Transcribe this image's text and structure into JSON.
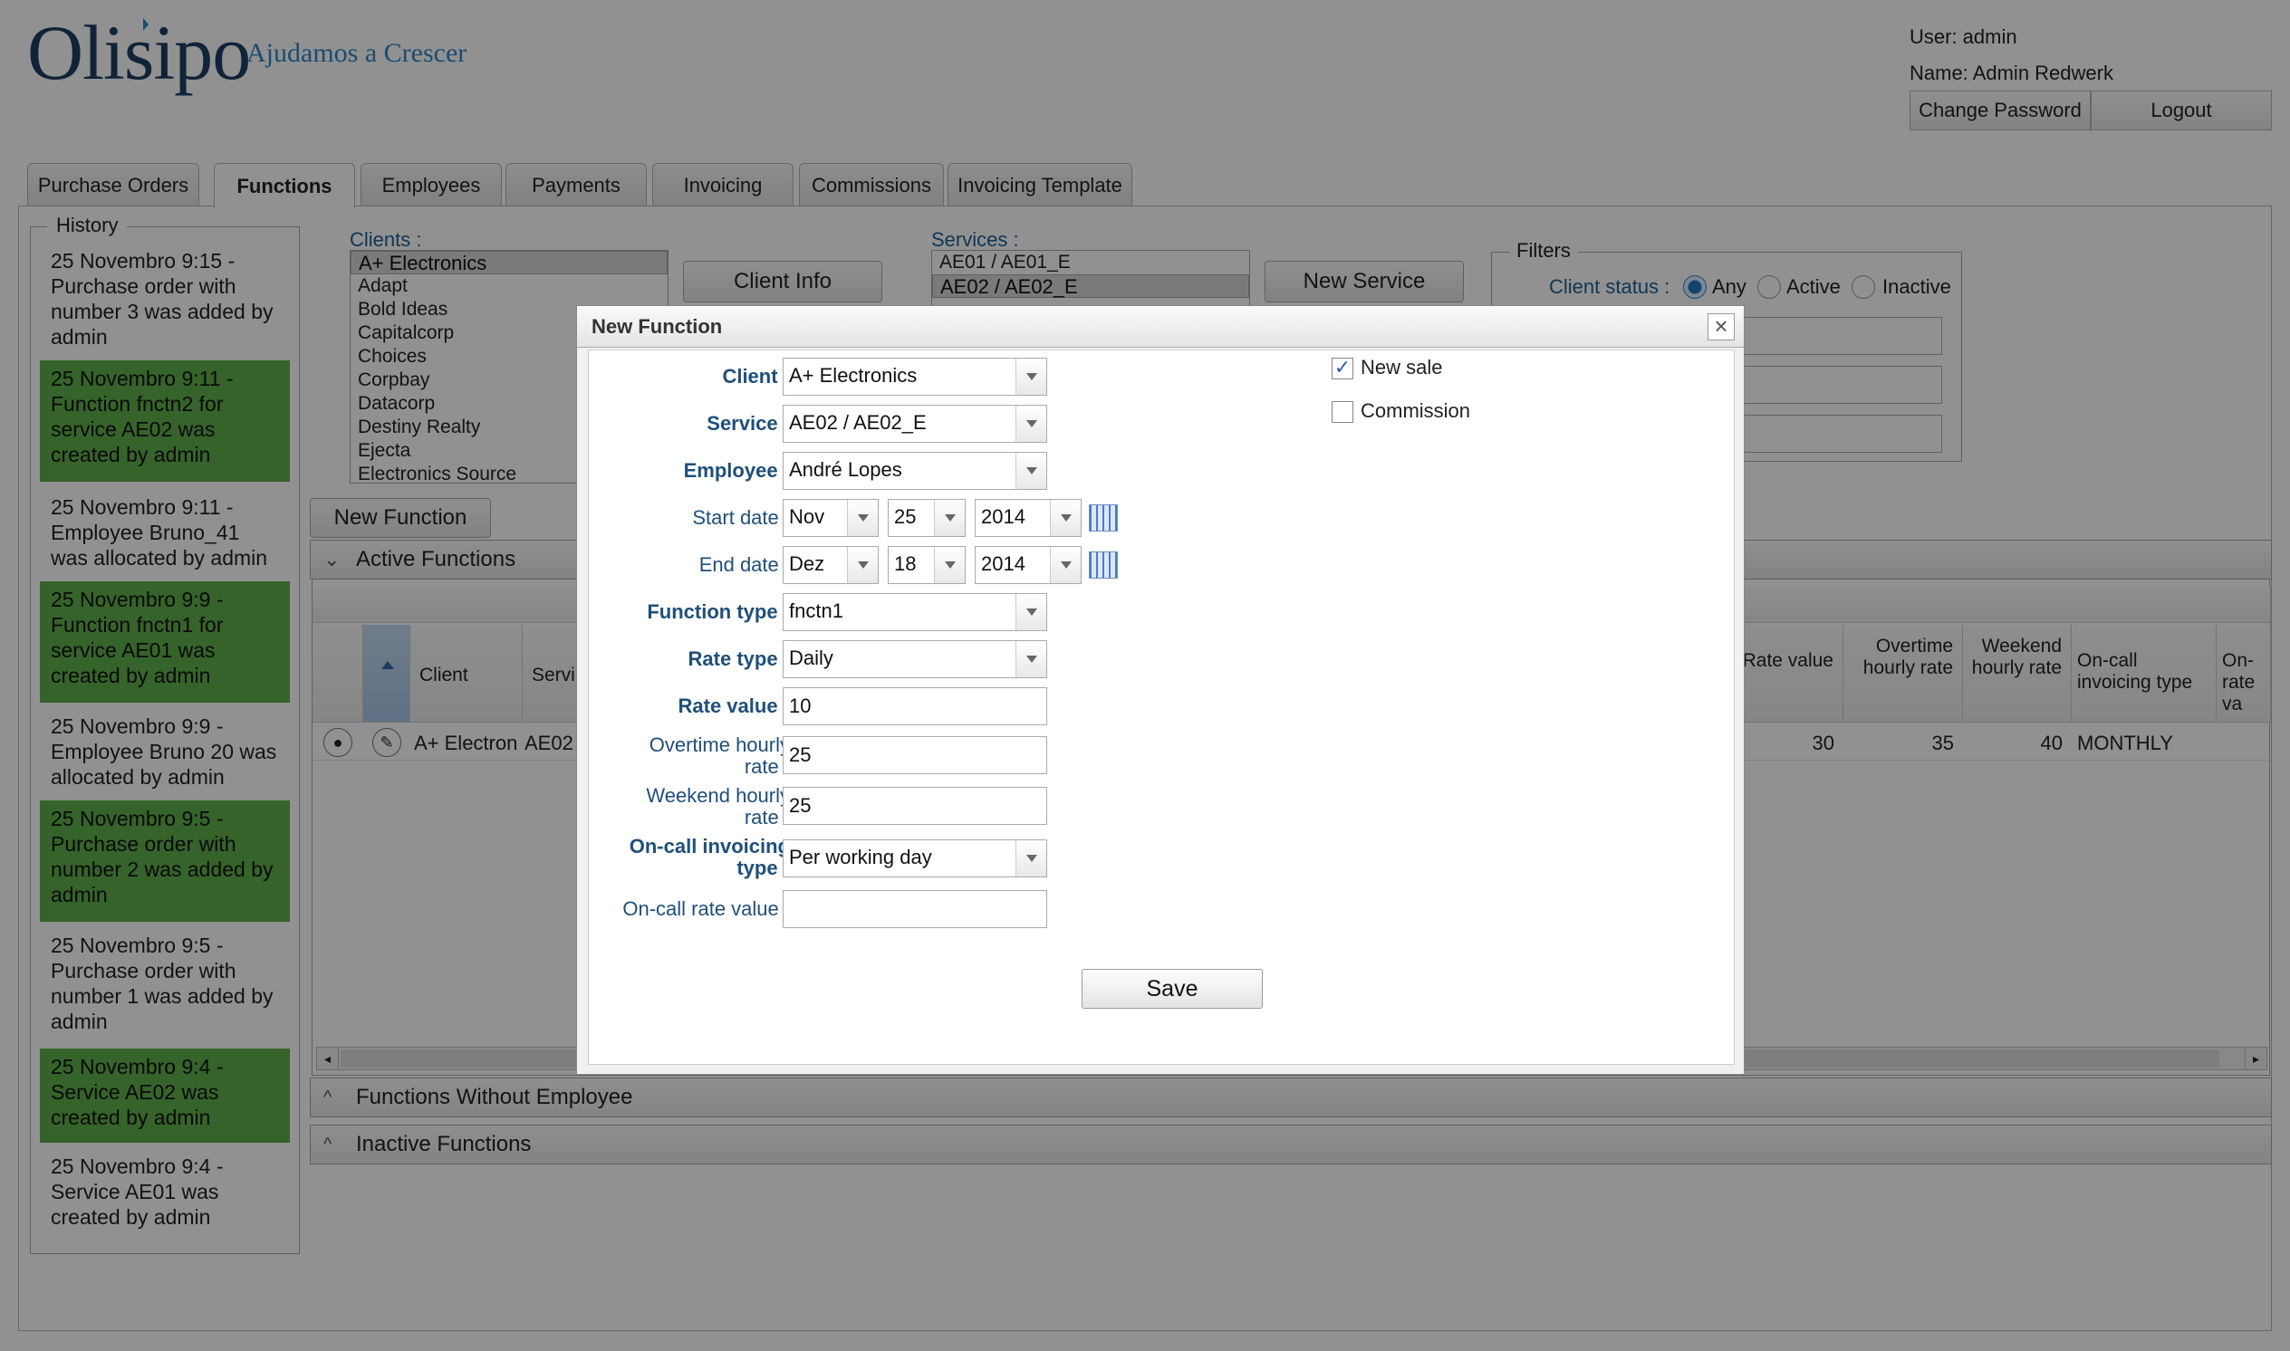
{
  "header": {
    "logo": "Olisipo",
    "tagline": "Ajudamos a Crescer",
    "user_line": "User: admin",
    "name_line": "Name: Admin Redwerk",
    "change_password": "Change Password",
    "logout": "Logout"
  },
  "tabs": [
    {
      "label": "Purchase Orders"
    },
    {
      "label": "Functions"
    },
    {
      "label": "Employees"
    },
    {
      "label": "Payments"
    },
    {
      "label": "Invoicing"
    },
    {
      "label": "Commissions"
    },
    {
      "label": "Invoicing Template"
    }
  ],
  "history": {
    "legend": "History",
    "items": [
      "25 Novembro 9:15 - Purchase order with number 3 was added by admin",
      "25 Novembro 9:11 - Function fnctn2 for service AE02 was created by admin",
      "25 Novembro 9:11 - Employee Bruno_41 was allocated by admin",
      "25 Novembro 9:9 - Function fnctn1 for service AE01 was created by admin",
      "25 Novembro 9:9 - Employee Bruno 20 was allocated by admin",
      "25 Novembro 9:5 - Purchase order with number 2 was added by admin",
      "25 Novembro 9:5 - Purchase order with number 1 was added by admin",
      "25 Novembro 9:4 - Service AE02 was created by admin",
      "25 Novembro 9:4 - Service AE01 was created by admin"
    ]
  },
  "clients": {
    "label": "Clients :",
    "items": [
      "A+ Electronics",
      "Adapt",
      "Bold Ideas",
      "Capitalcorp",
      "Choices",
      "Corpbay",
      "Datacorp",
      "Destiny Realty",
      "Ejecta",
      "Electronics Source"
    ],
    "info_button": "Client Info"
  },
  "services": {
    "label": "Services :",
    "items": [
      "AE01 / AE01_E",
      "AE02 / AE02_E"
    ],
    "new_button": "New Service"
  },
  "filters": {
    "legend": "Filters",
    "client_status_label": "Client status :",
    "options": [
      "Any",
      "Active",
      "Inactive"
    ]
  },
  "functions": {
    "new_button": "New Function",
    "active_title": "Active Functions",
    "without_employee_title": "Functions Without Employee",
    "inactive_title": "Inactive Functions",
    "columns": {
      "client": "Client",
      "service": "Servi",
      "rate_value": "Rate value",
      "overtime": "Overtime hourly rate",
      "weekend": "Weekend hourly rate",
      "oncall_type": "On-call invoicing type",
      "oncall_rate": "On- rate va"
    },
    "row": {
      "client": "A+ Electron",
      "service": "AE02",
      "rate_value": "30",
      "overtime": "35",
      "weekend": "40",
      "oncall_type": "MONTHLY"
    }
  },
  "modal": {
    "title": "New Function",
    "close": "×",
    "labels": {
      "client": "Client :",
      "service": "Service :",
      "employee": "Employee :",
      "start_date": "Start date :",
      "end_date": "End date :",
      "function_type": "Function type :",
      "rate_type": "Rate type :",
      "rate_value": "Rate value :",
      "overtime_1": "Overtime hourly",
      "overtime_2": "rate :",
      "weekend_1": "Weekend hourly",
      "weekend_2": "rate :",
      "oncall_type_1": "On-call invoicing",
      "oncall_type_2": "type :",
      "oncall_rate": "On-call rate value :"
    },
    "values": {
      "client": "A+ Electronics",
      "service": "AE02 / AE02_E",
      "employee": "André Lopes",
      "start_month": "Nov",
      "start_day": "25",
      "start_year": "2014",
      "end_month": "Dez",
      "end_day": "18",
      "end_year": "2014",
      "function_type": "fnctn1",
      "rate_type": "Daily",
      "rate_value": "10",
      "overtime": "25",
      "weekend": "25",
      "oncall_type": "Per working day",
      "oncall_rate": ""
    },
    "checkboxes": {
      "new_sale": "New sale",
      "new_sale_checked": true,
      "commission": "Commission",
      "commission_checked": false
    },
    "save": "Save"
  },
  "colors": {
    "green_history": "#5fae48",
    "label_blue": "#1f5f96",
    "logo": "#1f3f63",
    "accent": "#2f86c8"
  }
}
